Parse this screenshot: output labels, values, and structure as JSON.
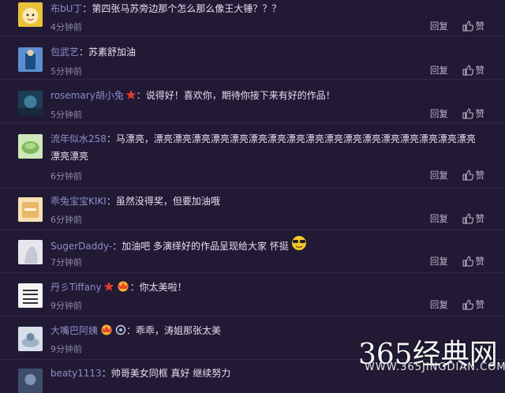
{
  "comments": [
    {
      "user": "布bU丁",
      "text": "第四张马苏旁边那个怎么那么像王大锤？？？",
      "time": "4分钟前",
      "avatar_color": "#e8c33a"
    },
    {
      "user": "包武艺",
      "text": "苏素舒加油",
      "time": "5分钟前",
      "avatar_color": "#3b6fb0"
    },
    {
      "user": "rosemary胡小兔",
      "text": "说得好！喜欢你，期待你接下来有好的作品！",
      "time": "5分钟前",
      "avatar_color": "#2f5f78",
      "badge": "star-icon"
    },
    {
      "user": "流年似水258",
      "text": "马漂亮，漂亮漂亮漂亮漂亮漂亮漂亮漂亮漂亮漂亮漂亮漂亮漂亮漂亮漂亮漂亮漂亮漂亮漂亮漂亮",
      "time": "6分钟前",
      "avatar_color": "#7fb85a"
    },
    {
      "user": "乖兔宝宝KIKI",
      "text": "虽然没得奖，但要加油哦",
      "time": "6分钟前",
      "avatar_color": "#e8b86a"
    },
    {
      "user": "SugerDaddy-",
      "text": "加油吧 多演绎好的作品呈现给大家 怀挺",
      "time": "7分钟前",
      "avatar_color": "#dcdde6",
      "emoji": "sunglasses-emoji"
    },
    {
      "user": "丹彡Tiffany",
      "text": "你太美啦！",
      "time": "9分钟前",
      "avatar_color": "#f2f2f2",
      "avatar_text": "学到 互存"
    },
    {
      "user": "大嘴巴阿姨",
      "text": "乖乖，涛姐那张太美",
      "time": "9分钟前",
      "avatar_color": "#b9c6d4"
    },
    {
      "user": "beaty1113",
      "text": "帅哥美女同框 真好 继续努力",
      "time": "",
      "avatar_color": "#4a5a78"
    }
  ],
  "actions": {
    "reply": "回复",
    "like": "赞"
  },
  "watermark": {
    "title": "365经典网",
    "url": "WWW.365JINGDIAN.COM"
  }
}
